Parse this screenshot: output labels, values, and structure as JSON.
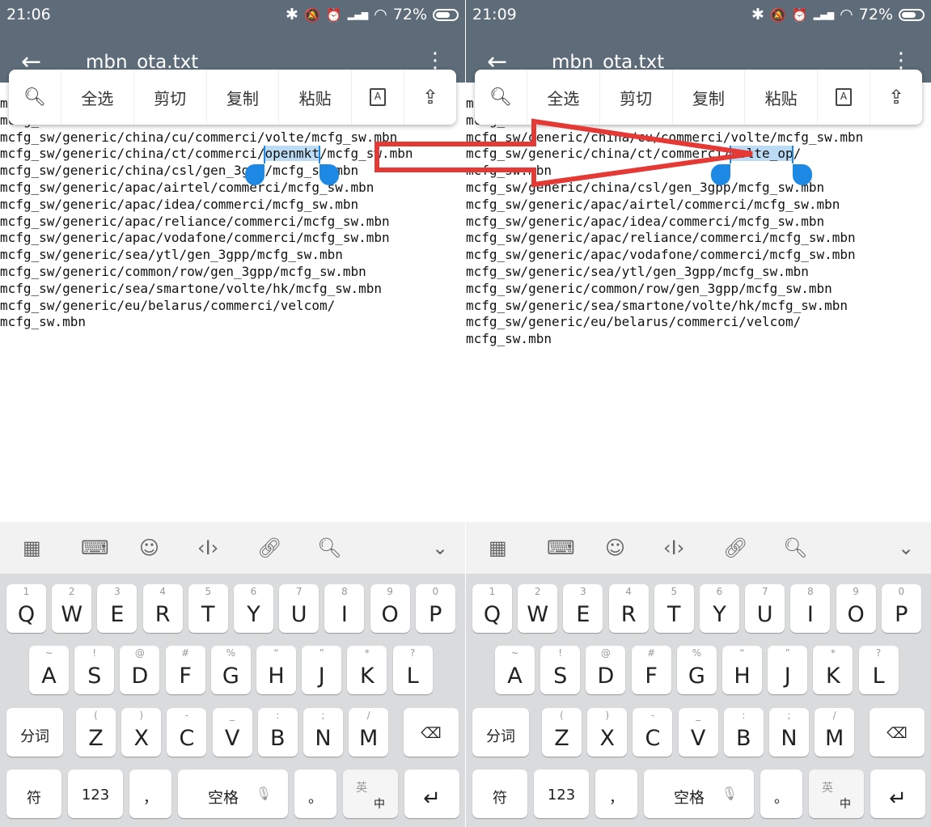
{
  "panels": [
    {
      "status": {
        "time": "21:06",
        "battery": "72%"
      },
      "appbar": {
        "title": "mbn_ota.txt"
      },
      "toolbar": {
        "select_all": "全选",
        "cut": "剪切",
        "copy": "复制",
        "paste": "粘贴"
      },
      "lines": [
        {
          "pre": "m",
          "sel": "",
          "post": ""
        },
        {
          "pre": "mcfg_sw.mbn",
          "sel": "",
          "post": ""
        },
        {
          "pre": "mcfg_sw/generic/china/cu/commerci/volte/mcfg_sw.mbn",
          "sel": "",
          "post": ""
        },
        {
          "pre": "mcfg_sw/generic/china/ct/commerci/",
          "sel": "openmkt",
          "post": "/mcfg_sw.mbn"
        },
        {
          "pre": "mcfg_sw/generic/china/csl/gen_3gpp/mcfg_sw.mbn",
          "sel": "",
          "post": ""
        },
        {
          "pre": "mcfg_sw/generic/apac/airtel/commerci/mcfg_sw.mbn",
          "sel": "",
          "post": ""
        },
        {
          "pre": "mcfg_sw/generic/apac/idea/commerci/mcfg_sw.mbn",
          "sel": "",
          "post": ""
        },
        {
          "pre": "mcfg_sw/generic/apac/reliance/commerci/mcfg_sw.mbn",
          "sel": "",
          "post": ""
        },
        {
          "pre": "mcfg_sw/generic/apac/vodafone/commerci/mcfg_sw.mbn",
          "sel": "",
          "post": ""
        },
        {
          "pre": "mcfg_sw/generic/sea/ytl/gen_3gpp/mcfg_sw.mbn",
          "sel": "",
          "post": ""
        },
        {
          "pre": "mcfg_sw/generic/common/row/gen_3gpp/mcfg_sw.mbn",
          "sel": "",
          "post": ""
        },
        {
          "pre": "mcfg_sw/generic/sea/smartone/volte/hk/mcfg_sw.mbn",
          "sel": "",
          "post": ""
        },
        {
          "pre": "mcfg_sw/generic/eu/belarus/commerci/velcom/",
          "sel": "",
          "post": ""
        },
        {
          "pre": "mcfg_sw.mbn",
          "sel": "",
          "post": ""
        }
      ]
    },
    {
      "status": {
        "time": "21:09",
        "battery": "72%"
      },
      "appbar": {
        "title": "mbn_ota.txt"
      },
      "toolbar": {
        "select_all": "全选",
        "cut": "剪切",
        "copy": "复制",
        "paste": "粘贴"
      },
      "lines": [
        {
          "pre": "m",
          "sel": "",
          "post": ""
        },
        {
          "pre": "mcfg_sw.mbn",
          "sel": "",
          "post": ""
        },
        {
          "pre": "mcfg_sw/generic/china/cu/commerci/volte/mcfg_sw.mbn",
          "sel": "",
          "post": ""
        },
        {
          "pre": "mcfg_sw/generic/china/ct/commerci/",
          "sel": "volte_op",
          "post": "/"
        },
        {
          "pre": "mcfg_sw.mbn",
          "sel": "",
          "post": ""
        },
        {
          "pre": "mcfg_sw/generic/china/csl/gen_3gpp/mcfg_sw.mbn",
          "sel": "",
          "post": ""
        },
        {
          "pre": "mcfg_sw/generic/apac/airtel/commerci/mcfg_sw.mbn",
          "sel": "",
          "post": ""
        },
        {
          "pre": "mcfg_sw/generic/apac/idea/commerci/mcfg_sw.mbn",
          "sel": "",
          "post": ""
        },
        {
          "pre": "mcfg_sw/generic/apac/reliance/commerci/mcfg_sw.mbn",
          "sel": "",
          "post": ""
        },
        {
          "pre": "mcfg_sw/generic/apac/vodafone/commerci/mcfg_sw.mbn",
          "sel": "",
          "post": ""
        },
        {
          "pre": "mcfg_sw/generic/sea/ytl/gen_3gpp/mcfg_sw.mbn",
          "sel": "",
          "post": ""
        },
        {
          "pre": "mcfg_sw/generic/common/row/gen_3gpp/mcfg_sw.mbn",
          "sel": "",
          "post": ""
        },
        {
          "pre": "mcfg_sw/generic/sea/smartone/volte/hk/mcfg_sw.mbn",
          "sel": "",
          "post": ""
        },
        {
          "pre": "mcfg_sw/generic/eu/belarus/commerci/velcom/",
          "sel": "",
          "post": ""
        },
        {
          "pre": "mcfg_sw.mbn",
          "sel": "",
          "post": ""
        }
      ]
    }
  ],
  "keyboard": {
    "row1": [
      {
        "main": "Q",
        "hint": "1"
      },
      {
        "main": "W",
        "hint": "2"
      },
      {
        "main": "E",
        "hint": "3"
      },
      {
        "main": "R",
        "hint": "4"
      },
      {
        "main": "T",
        "hint": "5"
      },
      {
        "main": "Y",
        "hint": "6"
      },
      {
        "main": "U",
        "hint": "7"
      },
      {
        "main": "I",
        "hint": "8"
      },
      {
        "main": "O",
        "hint": "9"
      },
      {
        "main": "P",
        "hint": "0"
      }
    ],
    "row2": [
      {
        "main": "A",
        "hint": "~"
      },
      {
        "main": "S",
        "hint": "!"
      },
      {
        "main": "D",
        "hint": "@"
      },
      {
        "main": "F",
        "hint": "#"
      },
      {
        "main": "G",
        "hint": "%"
      },
      {
        "main": "H",
        "hint": "“"
      },
      {
        "main": "J",
        "hint": "”"
      },
      {
        "main": "K",
        "hint": "*"
      },
      {
        "main": "L",
        "hint": "?"
      }
    ],
    "row3": [
      {
        "main": "Z",
        "hint": "("
      },
      {
        "main": "X",
        "hint": ")"
      },
      {
        "main": "C",
        "hint": "-"
      },
      {
        "main": "V",
        "hint": "_"
      },
      {
        "main": "B",
        "hint": ":"
      },
      {
        "main": "N",
        "hint": ";"
      },
      {
        "main": "M",
        "hint": "/"
      }
    ],
    "fenci": "分词",
    "fu": "符",
    "num": "123",
    "comma": "，",
    "space": "空格",
    "period": "。",
    "lang_top": "英",
    "lang_bottom": "中"
  },
  "icons": {
    "back": "arrow-left-icon",
    "menu": "kebab-menu-icon",
    "search": "search-icon",
    "translate": "text-recognition-icon",
    "share": "share-icon",
    "backspace": "backspace-icon",
    "enter": "enter-icon",
    "mic": "microphone-icon"
  },
  "colors": {
    "appbar": "#5e6c79",
    "selection": "#bcdcf5",
    "handle": "#1e88e5",
    "arrow": "#e53935",
    "keyboard_bg": "#d9dbdd"
  }
}
